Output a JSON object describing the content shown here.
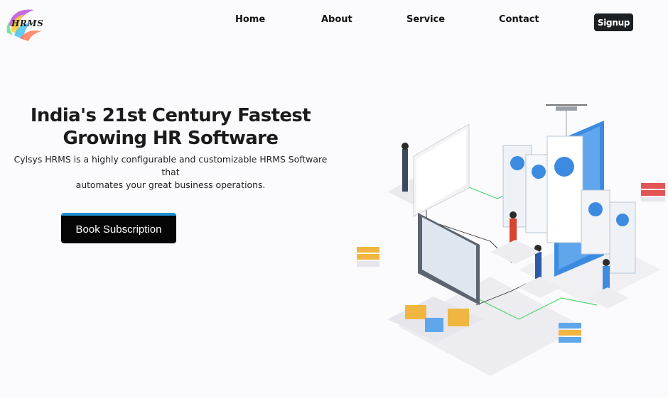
{
  "brand": {
    "logo_text": "HRMS"
  },
  "nav": {
    "items": [
      {
        "label": "Home"
      },
      {
        "label": "About"
      },
      {
        "label": "Service"
      },
      {
        "label": "Contact"
      }
    ],
    "signup_label": "Signup"
  },
  "hero": {
    "title_line1": "India's 21st Century Fastest",
    "title_line2": "Growing HR Software",
    "description_line1": "Cylsys HRMS is a highly configurable and customizable HRMS Software that",
    "description_line2": "automates your great business operations.",
    "cta_label": "Book Subscription"
  },
  "colors": {
    "accent": "#1f8fd1",
    "dark": "#050505",
    "illustration_blue": "#3d8be0",
    "line_green": "#4bd66a"
  }
}
